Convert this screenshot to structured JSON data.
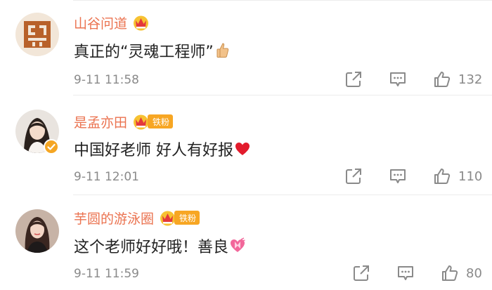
{
  "comments": [
    {
      "username": "山谷问道",
      "fan_tag": "",
      "text": "真正的“灵魂工程师”",
      "emoji": "thumbs-up-emoji",
      "timestamp": "9-11 11:58",
      "likes": "132",
      "avatar": "calligraphy-seal-avatar"
    },
    {
      "username": "是孟亦田",
      "fan_tag": "铁粉",
      "text": "中国好老师  好人有好报",
      "emoji": "red-heart-emoji",
      "timestamp": "9-11 12:01",
      "likes": "110",
      "avatar": "girl-portrait-avatar"
    },
    {
      "username": "芋圆的游泳圈",
      "fan_tag": "铁粉",
      "text": "这个老师好好哦！善良",
      "emoji": "heart-with-ribbon-emoji",
      "timestamp": "9-11 11:59",
      "likes": "80",
      "avatar": "woman-portrait-avatar"
    }
  ],
  "colors": {
    "username": "#eb7350",
    "badge_gold": "#f7a623",
    "meta_gray": "#8a8a8a",
    "text": "#222222"
  },
  "icons": [
    "share-icon",
    "comment-icon",
    "like-icon",
    "crown-badge-icon",
    "verified-icon"
  ]
}
